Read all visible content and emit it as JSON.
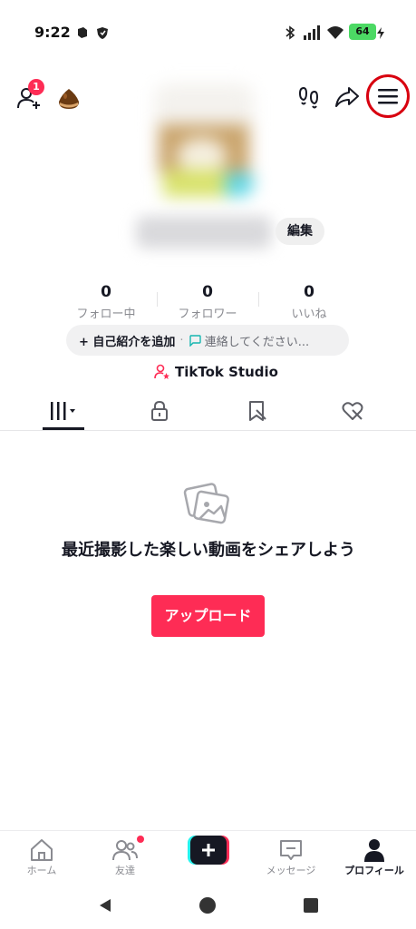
{
  "status_bar": {
    "time": "9:22",
    "battery": "64"
  },
  "header": {
    "notification_count": "1",
    "menu_highlight_color": "#d8000f"
  },
  "profile": {
    "edit_label": "編集"
  },
  "stats": [
    {
      "value": "0",
      "label": "フォロー中"
    },
    {
      "value": "0",
      "label": "フォロワー"
    },
    {
      "value": "0",
      "label": "いいね"
    }
  ],
  "bio": {
    "add_label": "+ 自己紹介を追加",
    "separator": "·",
    "contact_placeholder": "連絡してください..."
  },
  "studio": {
    "label": "TikTok Studio"
  },
  "tabs": [
    {
      "icon": "grid-icon",
      "active": true
    },
    {
      "icon": "lock-icon",
      "active": false
    },
    {
      "icon": "bookmark-icon",
      "active": false
    },
    {
      "icon": "liked-icon",
      "active": false
    }
  ],
  "empty_state": {
    "message": "最近撮影した楽しい動画をシェアしよう",
    "upload_label": "アップロード"
  },
  "bottom_nav": [
    {
      "label": "ホーム",
      "icon": "home-icon",
      "active": false
    },
    {
      "label": "友達",
      "icon": "friends-icon",
      "active": false
    },
    {
      "label": "",
      "icon": "create-plus-icon",
      "active": false
    },
    {
      "label": "メッセージ",
      "icon": "message-icon",
      "active": false
    },
    {
      "label": "プロフィール",
      "icon": "profile-icon",
      "active": true
    }
  ],
  "colors": {
    "accent": "#fe2c55",
    "text": "#161823",
    "muted": "#8a8b91"
  }
}
